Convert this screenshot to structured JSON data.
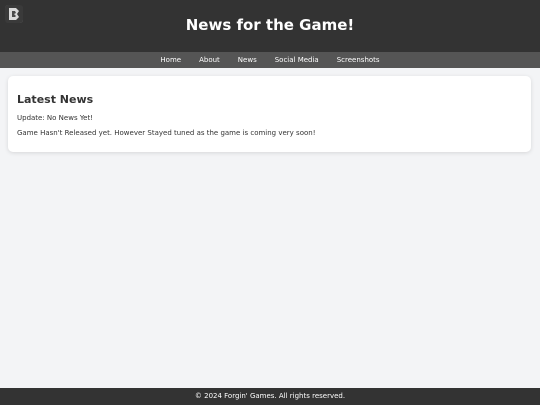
{
  "header": {
    "logo_icon": "game-logo-icon",
    "title": "News for the Game!"
  },
  "nav": {
    "items": [
      {
        "label": "Home"
      },
      {
        "label": "About"
      },
      {
        "label": "News"
      },
      {
        "label": "Social Media"
      },
      {
        "label": "Screenshots"
      }
    ]
  },
  "news": {
    "title": "Latest News",
    "update": "Update: No News Yet!",
    "body": "Game Hasn't Released yet. However Stayed tuned as the game is coming very soon!"
  },
  "footer": {
    "text": "© 2024 Forgin' Games. All rights reserved."
  },
  "colors": {
    "header_bg": "#333333",
    "nav_bg": "#555555",
    "page_bg": "#f3f4f6",
    "card_bg": "#ffffff",
    "text": "#333333"
  }
}
